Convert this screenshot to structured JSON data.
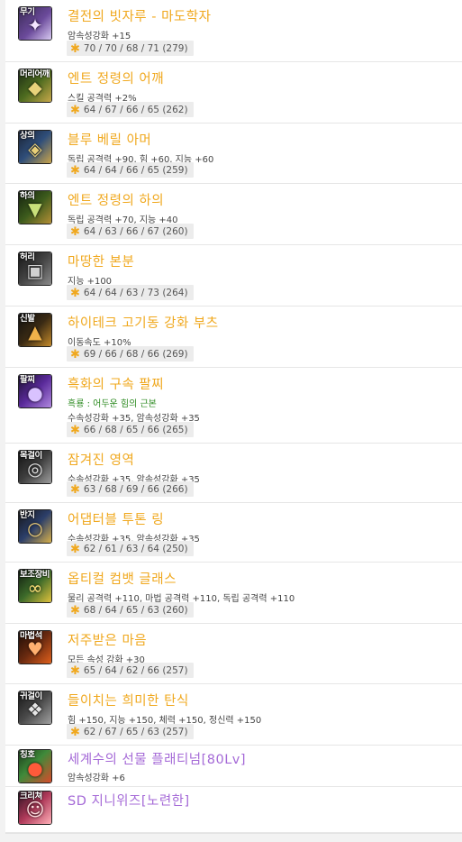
{
  "colors": {
    "name_orange": "#f0a81e",
    "name_purple": "#a56ad7",
    "set_green": "#2e8b22",
    "stat_bg": "#ececec"
  },
  "items": [
    {
      "slot": "무기",
      "icon": "weapon-staff-icon",
      "name": "결전의 빗자루 - 마도학자",
      "lines": [
        "암속성강화 +15"
      ],
      "stats": "70 / 70 / 68 / 71 (279)"
    },
    {
      "slot": "머리어깨",
      "icon": "shoulder-armor-icon",
      "name": "엔트 정령의 어깨",
      "lines": [
        "스킬 공격력 +2%"
      ],
      "stats": "64 / 67 / 66 / 65 (262)"
    },
    {
      "slot": "상의",
      "icon": "top-armor-icon",
      "name": "블루 베릴 아머",
      "lines": [
        "독립 공격력 +90, 힘 +60, 지능 +60"
      ],
      "stats": "64 / 64 / 66 / 65 (259)"
    },
    {
      "slot": "하의",
      "icon": "pants-armor-icon",
      "name": "엔트 정령의 하의",
      "lines": [
        "독립 공격력 +70, 지능 +40"
      ],
      "stats": "64 / 63 / 66 / 67 (260)"
    },
    {
      "slot": "허리",
      "icon": "belt-armor-icon",
      "name": "마땅한 본분",
      "lines": [
        "지능 +100"
      ],
      "stats": "64 / 64 / 63 / 73 (264)"
    },
    {
      "slot": "신발",
      "icon": "boots-armor-icon",
      "name": "하이테크 고기동 강화 부츠",
      "lines": [
        "이동속도 +10%"
      ],
      "stats": "69 / 66 / 68 / 66 (269)"
    },
    {
      "slot": "팔찌",
      "icon": "bracelet-icon",
      "name": "흑화의 구속 팔찌",
      "set_line": "흑룡 : 어두운 힘의 근본",
      "lines": [
        "수속성강화 +35, 암속성강화 +35"
      ],
      "stats": "66 / 68 / 65 / 66 (265)"
    },
    {
      "slot": "목걸이",
      "icon": "necklace-icon",
      "name": "잠겨진 영역",
      "lines": [
        "수속성강화 +35, 암속성강화 +35"
      ],
      "stats": "63 / 68 / 69 / 66 (266)"
    },
    {
      "slot": "반지",
      "icon": "ring-icon",
      "name": "어댑터블 투톤 링",
      "lines": [
        "수속성강화 +35, 암속성강화 +35"
      ],
      "stats": "62 / 61 / 63 / 64 (250)"
    },
    {
      "slot": "보조장비",
      "icon": "glasses-icon",
      "name": "옵티컬 컴뱃 글래스",
      "lines": [
        "물리 공격력 +110, 마법 공격력 +110, 독립 공격력 +110"
      ],
      "stats": "68 / 64 / 65 / 63 (260)"
    },
    {
      "slot": "마법석",
      "icon": "magic-stone-icon",
      "name": "저주받은 마음",
      "lines": [
        "모든 속성 강화 +30"
      ],
      "stats": "65 / 64 / 62 / 66 (257)"
    },
    {
      "slot": "귀걸이",
      "icon": "earring-icon",
      "name": "들이치는 희미한 탄식",
      "lines": [
        "힘 +150, 지능 +150, 체력 +150, 정신력 +150"
      ],
      "stats": "62 / 67 / 65 / 63 (257)"
    },
    {
      "slot": "칭호",
      "icon": "title-apple-icon",
      "name": "세계수의 선물 플래티넘[80Lv]",
      "lines": [
        "암속성강화 +6"
      ],
      "purple": true
    },
    {
      "slot": "크리쳐",
      "icon": "creature-icon",
      "name": "SD 지니위즈[노련한]",
      "lines": [],
      "purple": true
    }
  ]
}
